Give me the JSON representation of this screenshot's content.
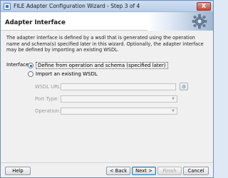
{
  "window": {
    "title": "FILE Adapter Configuration Wizard - Step 3 of 4",
    "close_glyph": "X"
  },
  "header": {
    "title": "Adapter Interface"
  },
  "description": "The adapter interface is defined by a wsdl that is generated using the operation name and schema(s) specified later in this wizard.  Optionally, the adapter interface may be defined by importing an existing WSDL.",
  "interface": {
    "label": "Interface:",
    "option_define": "Define from operation and schema (specified later)",
    "option_import": "Import an existing WSDL",
    "selected": "define"
  },
  "fields": {
    "wsdl_url_label": "WSDL URL:",
    "wsdl_url_value": "",
    "port_type_label": "Port Type:",
    "port_type_value": "",
    "operation_label": "Operation:",
    "operation_value": ""
  },
  "buttons": {
    "help": "Help",
    "back": "< Back",
    "next": "Next >",
    "finish": "Finish",
    "cancel": "Cancel"
  }
}
